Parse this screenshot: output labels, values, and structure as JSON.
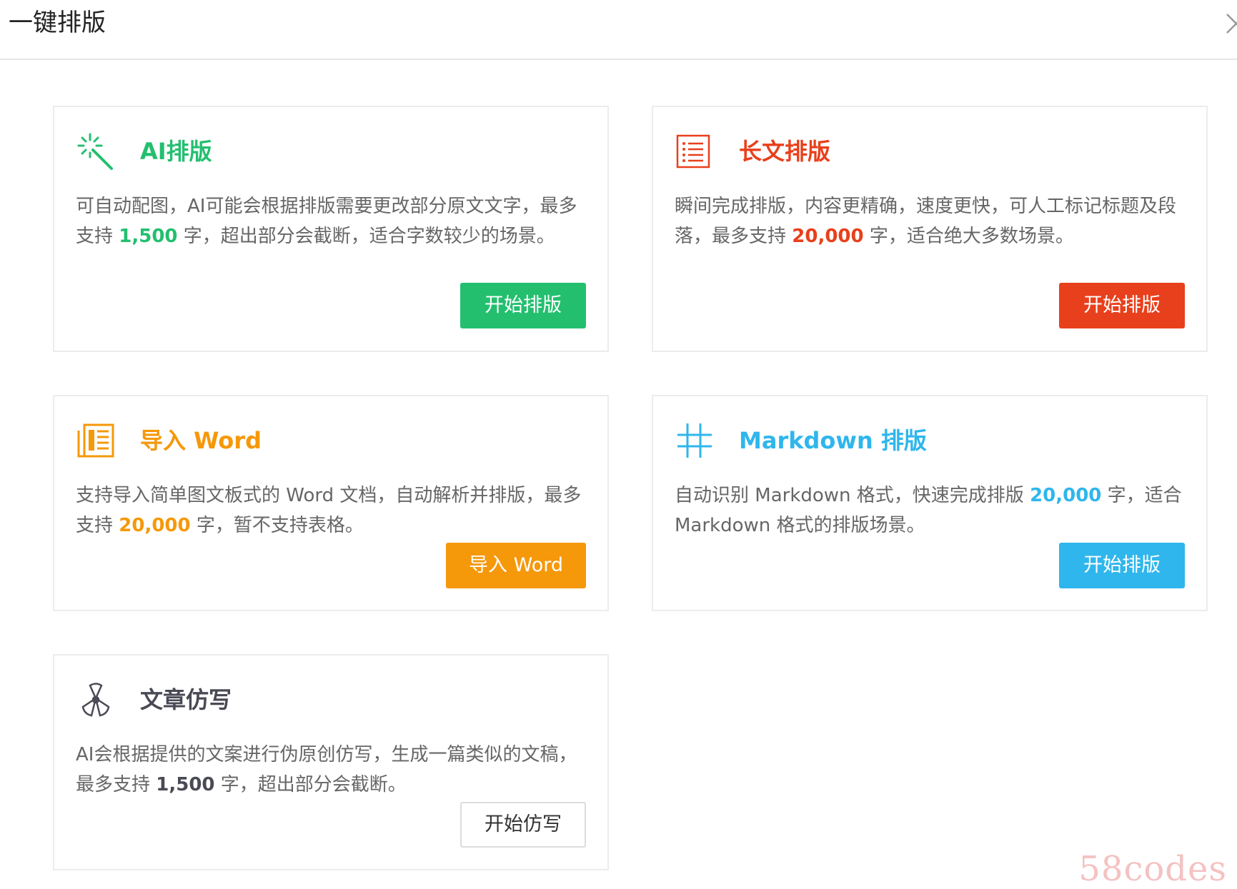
{
  "dialog": {
    "title": "一键排版"
  },
  "colors": {
    "green": "#23bf6f",
    "red": "#e8401c",
    "orange": "#f5980a",
    "blue": "#2fb6ec",
    "gray": "#4a4a55"
  },
  "cards": [
    {
      "title": "AI排版",
      "icon": "magic-wand-icon",
      "desc_before": "可自动配图，AI可能会根据排版需要更改部分原文文字，最多支持 ",
      "desc_number": "1,500",
      "desc_after": " 字，超出部分会截断，适合字数较少的场景。",
      "button": "开始排版"
    },
    {
      "title": "长文排版",
      "icon": "list-icon",
      "desc_before": "瞬间完成排版，内容更精确，速度更快，可人工标记标题及段落，最多支持 ",
      "desc_number": "20,000",
      "desc_after": " 字，适合绝大多数场景。",
      "button": "开始排版"
    },
    {
      "title": "导入 Word",
      "icon": "document-icon",
      "desc_before": "支持导入简单图文板式的 Word 文档，自动解析并排版，最多支持 ",
      "desc_number": "20,000",
      "desc_after": " 字，暂不支持表格。",
      "button": "导入 Word"
    },
    {
      "title": "Markdown 排版",
      "icon": "hash-icon",
      "desc_before": "自动识别 Markdown 格式，快速完成排版 ",
      "desc_number": "20,000",
      "desc_after": " 字，适合 Markdown 格式的排版场景。",
      "button": "开始排版"
    },
    {
      "title": "文章仿写",
      "icon": "fan-icon",
      "desc_before": "AI会根据提供的文案进行伪原创仿写，生成一篇类似的文稿，最多支持 ",
      "desc_number": "1,500",
      "desc_after": " 字，超出部分会截断。",
      "button": "开始仿写"
    }
  ],
  "watermark": "58codes"
}
